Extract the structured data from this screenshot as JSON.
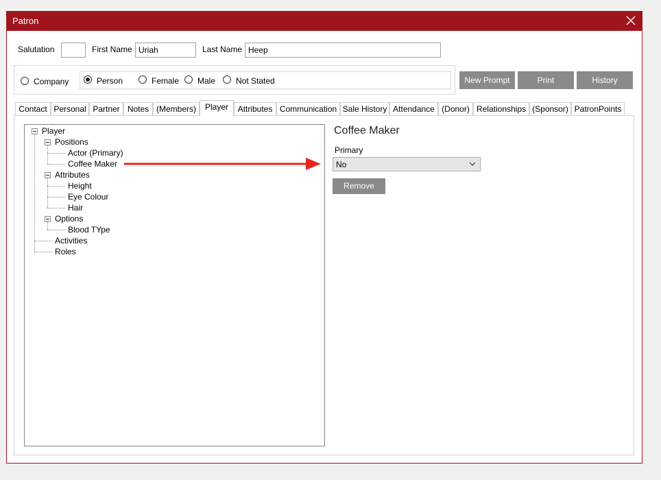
{
  "window": {
    "title": "Patron"
  },
  "header": {
    "salutation_label": "Salutation",
    "salutation_value": "",
    "first_name_label": "First Name",
    "first_name_value": "Uriah",
    "last_name_label": "Last Name",
    "last_name_value": "Heep"
  },
  "patron_type": {
    "company": "Company",
    "person": "Person",
    "female": "Female",
    "male": "Male",
    "not_stated": "Not Stated",
    "selected": "Person"
  },
  "actions": {
    "new_prompt": "New Prompt",
    "print": "Print",
    "history": "History"
  },
  "tabs": [
    {
      "label": "Contact"
    },
    {
      "label": "Personal"
    },
    {
      "label": "Partner"
    },
    {
      "label": "Notes"
    },
    {
      "label": "(Members)"
    },
    {
      "label": "Player"
    },
    {
      "label": "Attributes"
    },
    {
      "label": "Communication"
    },
    {
      "label": "Sale History"
    },
    {
      "label": "Attendance"
    },
    {
      "label": "(Donor)"
    },
    {
      "label": "Relationships"
    },
    {
      "label": "(Sponsor)"
    },
    {
      "label": "PatronPoints"
    }
  ],
  "active_tab": "Player",
  "tree": {
    "root": "Player",
    "positions": "Positions",
    "actor_primary": "Actor (Primary)",
    "coffee_maker": "Coffee Maker",
    "attributes": "Attributes",
    "height": "Height",
    "eye_colour": "Eye Colour",
    "hair": "Hair",
    "options": "Options",
    "blood_type": "Blood TYpe",
    "activities": "Activities",
    "roles": "Roles"
  },
  "detail": {
    "title": "Coffee Maker",
    "primary_label": "Primary",
    "primary_value": "No",
    "remove_label": "Remove"
  },
  "colors": {
    "titlebar": "#a0141e",
    "button": "#8a8a8a",
    "arrow": "#e8271c"
  }
}
